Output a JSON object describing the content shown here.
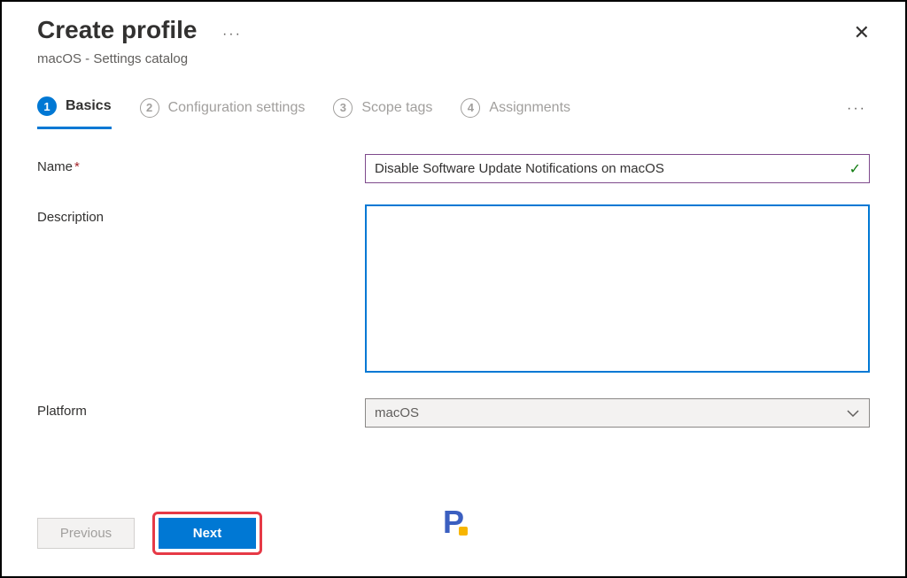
{
  "header": {
    "title": "Create profile",
    "subtitle": "macOS - Settings catalog"
  },
  "tabs": {
    "items": [
      {
        "num": "1",
        "label": "Basics"
      },
      {
        "num": "2",
        "label": "Configuration settings"
      },
      {
        "num": "3",
        "label": "Scope tags"
      },
      {
        "num": "4",
        "label": "Assignments"
      }
    ]
  },
  "form": {
    "name_label": "Name",
    "name_value": "Disable Software Update Notifications on macOS",
    "description_label": "Description",
    "description_value": "",
    "platform_label": "Platform",
    "platform_value": "macOS"
  },
  "footer": {
    "previous": "Previous",
    "next": "Next"
  },
  "watermark": "P"
}
